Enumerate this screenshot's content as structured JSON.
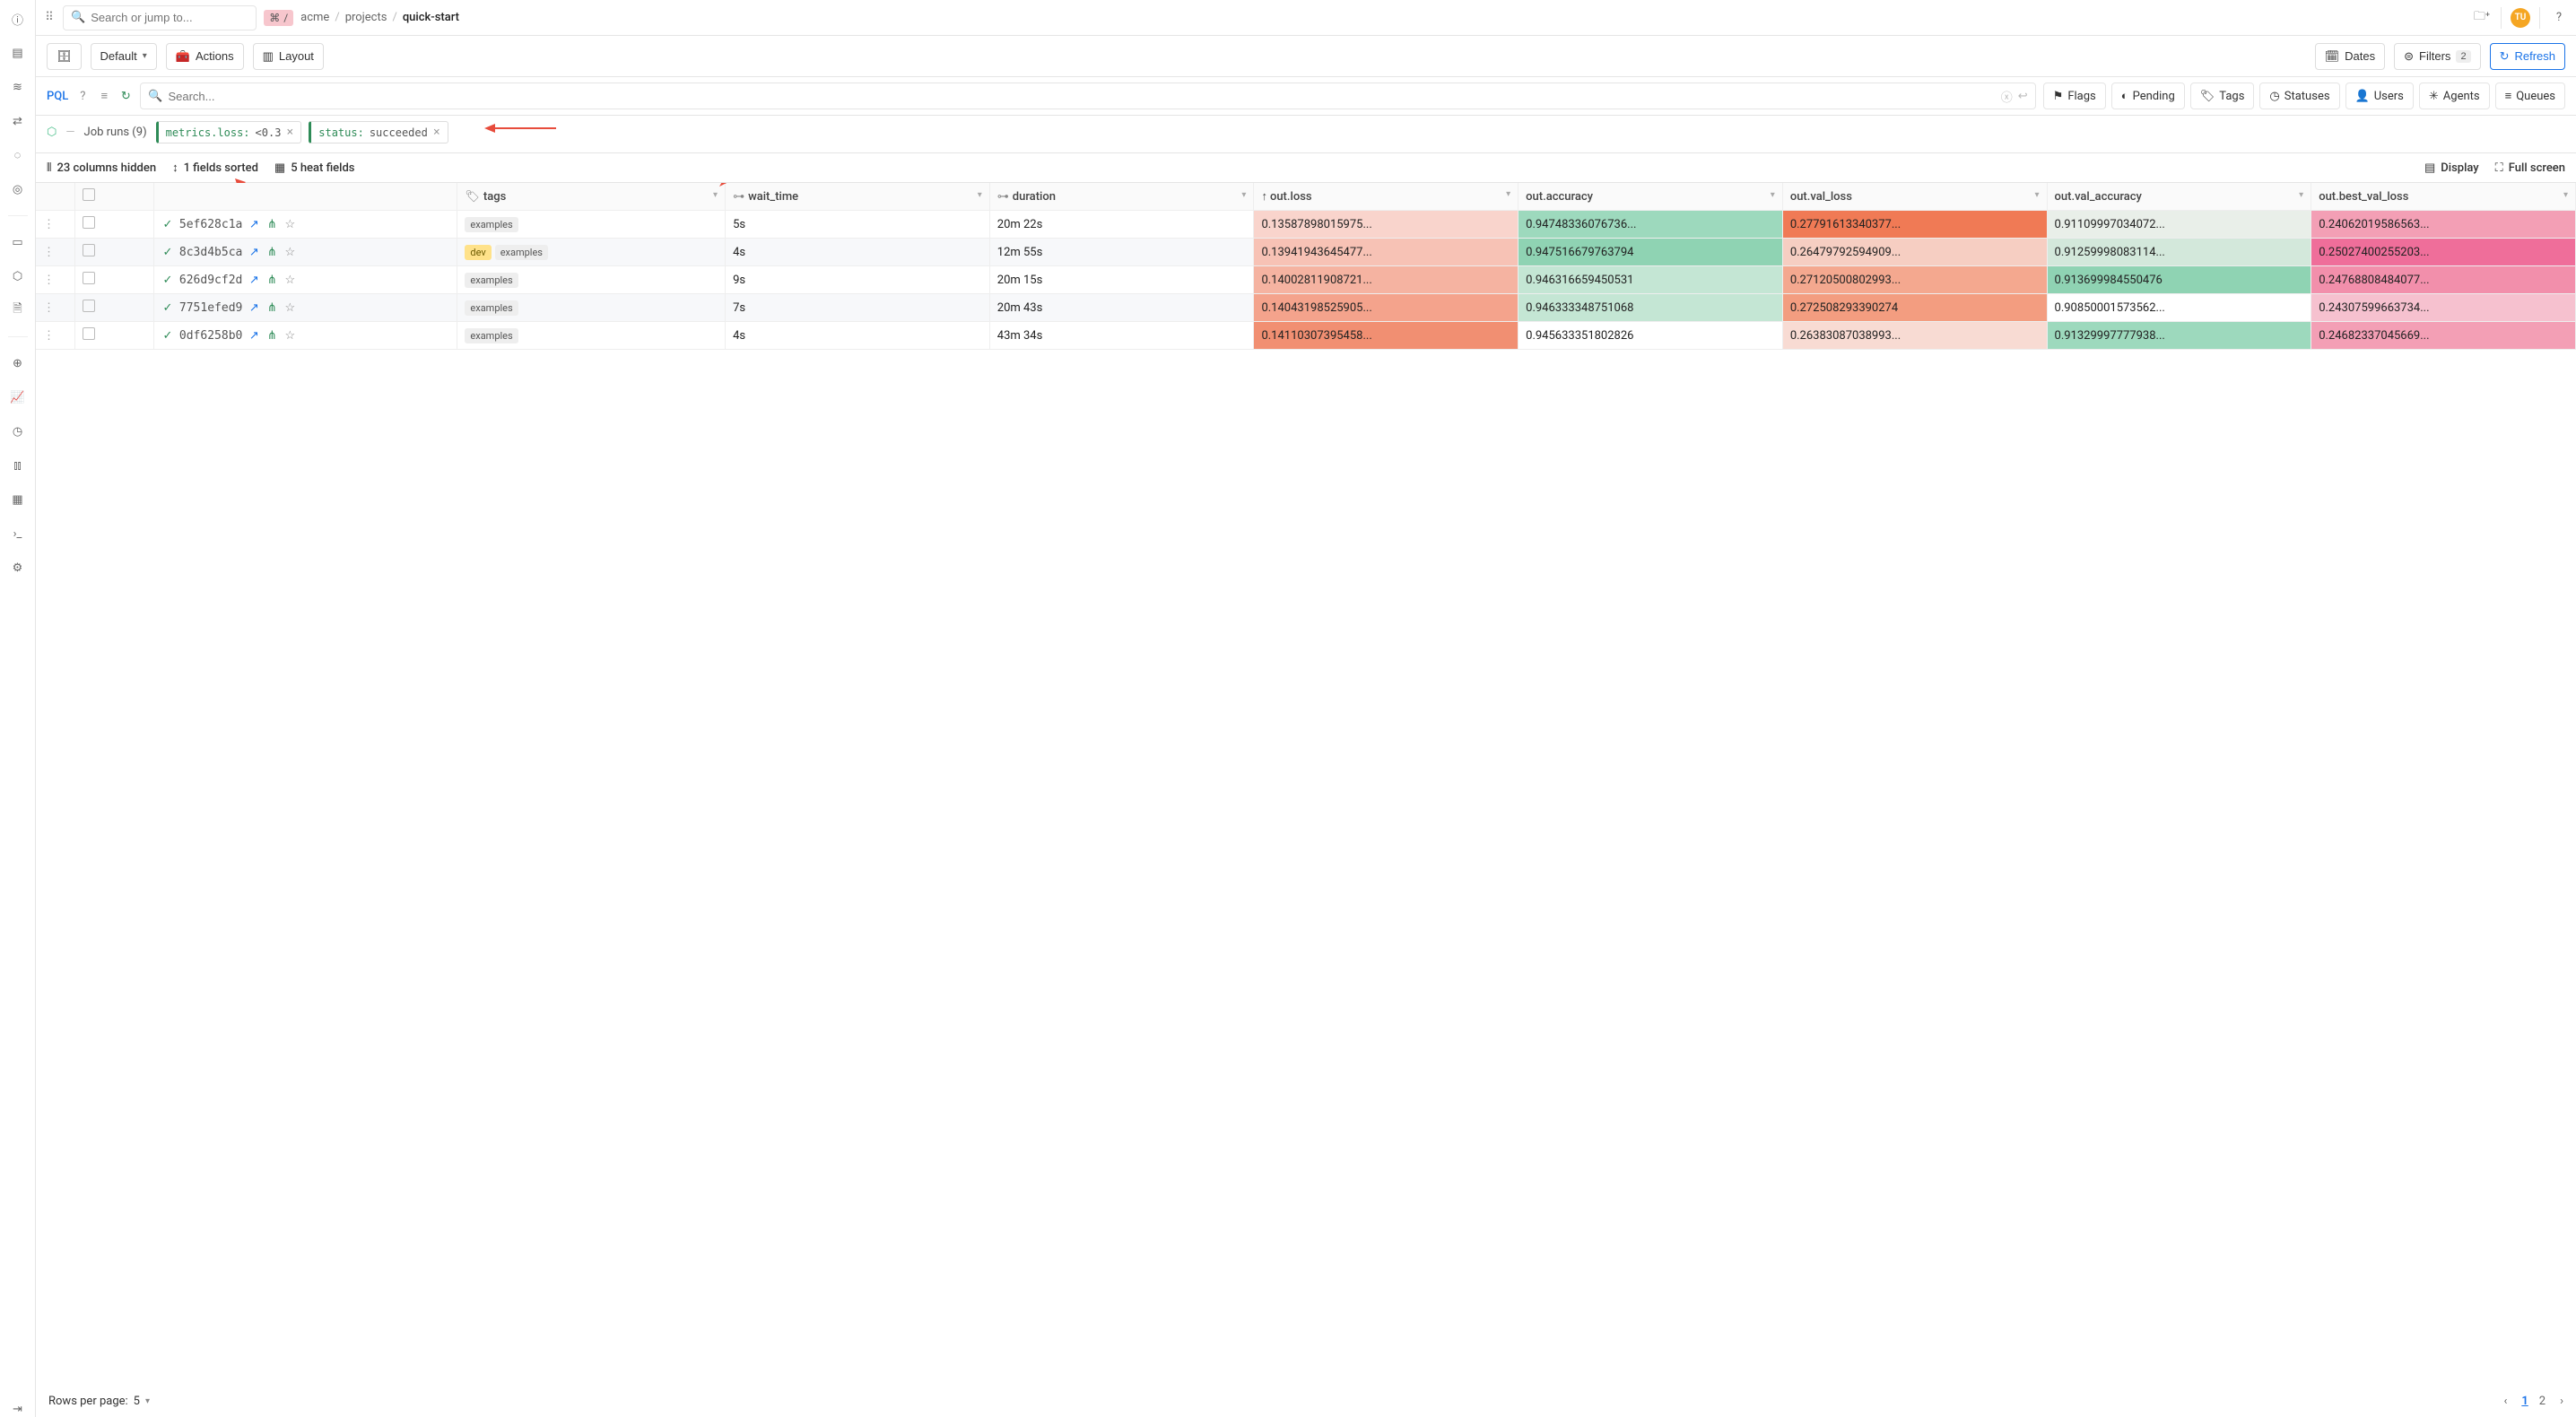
{
  "topbar": {
    "search_placeholder": "Search or jump to...",
    "cmd_key": "⌘",
    "breadcrumb": [
      "acme",
      "projects",
      "quick-start"
    ],
    "avatar_initials": "TU"
  },
  "toolbar": {
    "save_icon": "save",
    "default_label": "Default",
    "actions_label": "Actions",
    "layout_label": "Layout",
    "dates_label": "Dates",
    "filters_label": "Filters",
    "filters_count": "2",
    "refresh_label": "Refresh"
  },
  "querybar": {
    "pql_label": "PQL",
    "search_placeholder": "Search...",
    "facets": [
      "Flags",
      "Pending",
      "Tags",
      "Statuses",
      "Users",
      "Agents",
      "Queues"
    ]
  },
  "chipsrow": {
    "job_runs_label": "Job runs (9)",
    "chips": [
      {
        "key": "metrics.loss:",
        "value": "<0.3"
      },
      {
        "key": "status:",
        "value": "succeeded"
      }
    ]
  },
  "table_controls": {
    "hidden_cols": "23 columns hidden",
    "sorted": "1 fields sorted",
    "heat": "5 heat fields",
    "display": "Display",
    "fullscreen": "Full screen"
  },
  "columns": {
    "tags": "tags",
    "wait_time": "wait_time",
    "duration": "duration",
    "out_loss": "out.loss",
    "out_accuracy": "out.accuracy",
    "out_val_loss": "out.val_loss",
    "out_val_accuracy": "out.val_accuracy",
    "out_best_val_loss": "out.best_val_loss"
  },
  "rows": [
    {
      "id": "5ef628c1a",
      "tags": [
        "examples"
      ],
      "wait_time": "5s",
      "duration": "20m 22s",
      "out_loss": "0.13587898015975...",
      "out_accuracy": "0.94748336076736...",
      "out_val_loss": "0.27791613340377...",
      "out_val_accuracy": "0.91109997034072...",
      "out_best_val_loss": "0.24062019586563...",
      "heat": {
        "loss": "#f9d4cc",
        "acc": "#9dd9bd",
        "vloss": "#f07a55",
        "vacc": "#e9efe9",
        "bvl": "#f39fb5"
      }
    },
    {
      "id": "8c3d4b5ca",
      "tags": [
        "dev",
        "examples"
      ],
      "wait_time": "4s",
      "duration": "12m 55s",
      "out_loss": "0.13941943645477...",
      "out_accuracy": "0.947516679763794",
      "out_val_loss": "0.26479792594909...",
      "out_val_accuracy": "0.91259998083114...",
      "out_best_val_loss": "0.25027400255203...",
      "heat": {
        "loss": "#f7c2b5",
        "acc": "#8fd3b3",
        "vloss": "#f6cec2",
        "vacc": "#d3e8db",
        "bvl": "#ef6e9a"
      }
    },
    {
      "id": "626d9cf2d",
      "tags": [
        "examples"
      ],
      "wait_time": "9s",
      "duration": "20m 15s",
      "out_loss": "0.14002811908721...",
      "out_accuracy": "0.946316659450531",
      "out_val_loss": "0.27120500802993...",
      "out_val_accuracy": "0.913699984550476",
      "out_best_val_loss": "0.24768808484077...",
      "heat": {
        "loss": "#f5b3a1",
        "acc": "#c4e6d4",
        "vloss": "#f4a88f",
        "vacc": "#8fd3b3",
        "bvl": "#f28fab"
      }
    },
    {
      "id": "7751efed9",
      "tags": [
        "examples"
      ],
      "wait_time": "7s",
      "duration": "20m 43s",
      "out_loss": "0.14043198525905...",
      "out_accuracy": "0.946333348751068",
      "out_val_loss": "0.272508293390274",
      "out_val_accuracy": "0.90850001573562...",
      "out_best_val_loss": "0.24307599663734...",
      "heat": {
        "loss": "#f4a38c",
        "acc": "#c4e6d4",
        "vloss": "#f39d80",
        "vacc": "#ffffff",
        "bvl": "#f6c1cf"
      }
    },
    {
      "id": "0df6258b0",
      "tags": [
        "examples"
      ],
      "wait_time": "4s",
      "duration": "43m 34s",
      "out_loss": "0.14110307395458...",
      "out_accuracy": "0.945633351802826",
      "out_val_loss": "0.26383087038993...",
      "out_val_accuracy": "0.91329997777938...",
      "out_best_val_loss": "0.24682337045669...",
      "heat": {
        "loss": "#f18f72",
        "acc": "#ffffff",
        "vloss": "#f8dbd3",
        "vacc": "#9dd9bd",
        "bvl": "#f39fb5"
      }
    }
  ],
  "footer": {
    "rpp_label": "Rows per page:",
    "rpp_value": "5",
    "pages": [
      "1",
      "2"
    ],
    "active_page": "1"
  }
}
